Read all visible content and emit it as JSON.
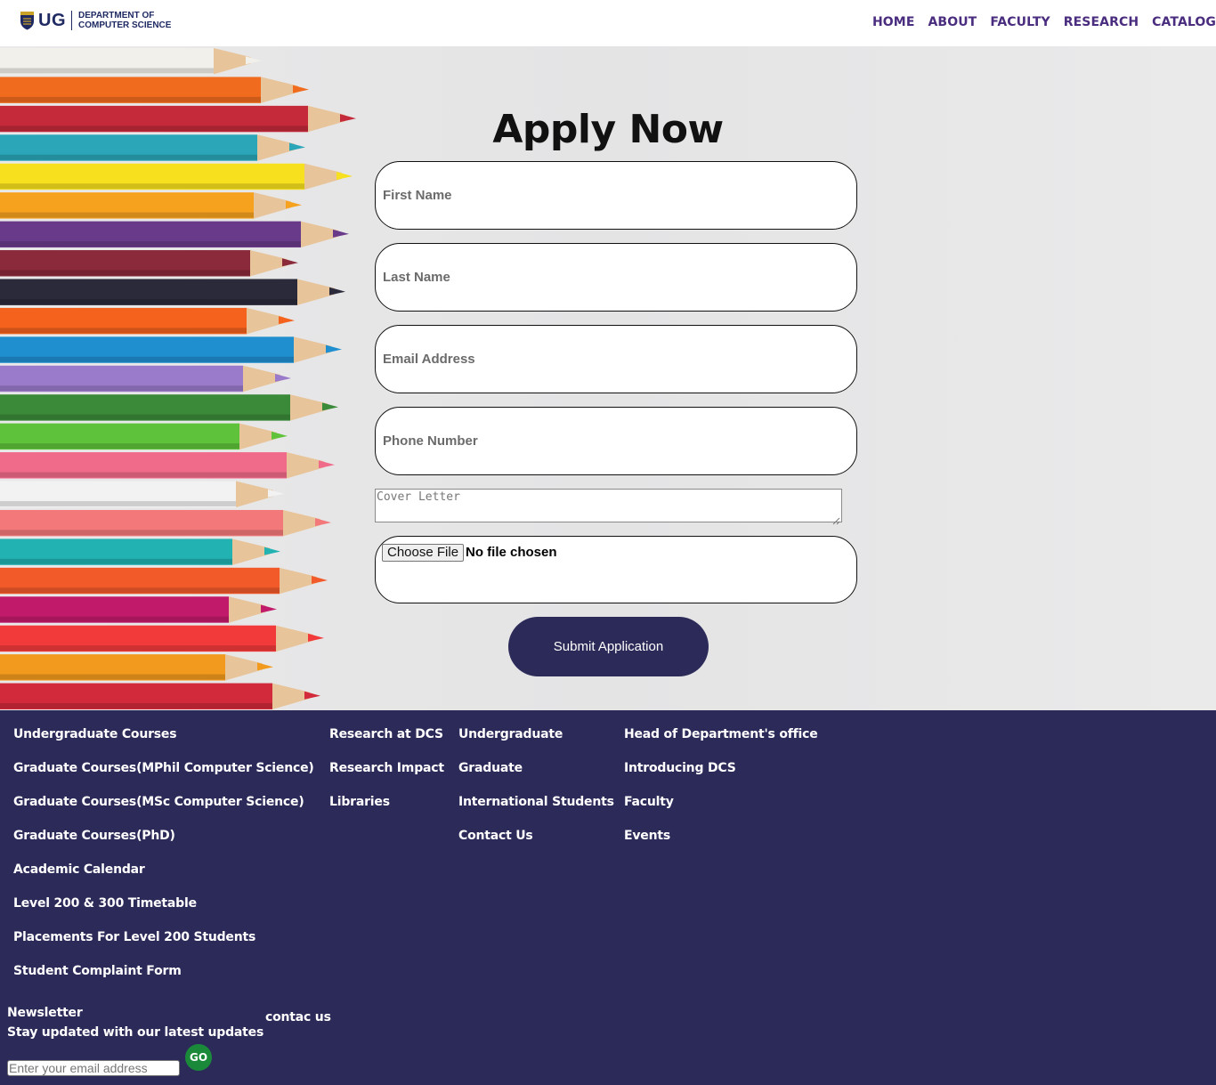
{
  "header": {
    "logo_text": "UG",
    "dept_line1": "DEPARTMENT OF",
    "dept_line2": "COMPUTER SCIENCE",
    "nav": [
      "HOME",
      "ABOUT",
      "FACULTY",
      "RESEARCH",
      "CATALOG"
    ]
  },
  "form": {
    "title": "Apply Now",
    "first_name_placeholder": "First Name",
    "last_name_placeholder": "Last Name",
    "email_placeholder": "Email Address",
    "phone_placeholder": "Phone Number",
    "cover_placeholder": "Cover Letter",
    "choose_file_label": "Choose File",
    "no_file_text": "No file chosen",
    "submit_label": "Submit Application"
  },
  "footer": {
    "columns": [
      [
        "Undergraduate Courses",
        "Graduate Courses(MPhil Computer Science)",
        "Graduate Courses(MSc Computer Science)",
        "Graduate Courses(PhD)",
        "Academic Calendar",
        "Level 200 & 300 Timetable",
        "Placements For Level 200 Students",
        "Student Complaint Form"
      ],
      [
        "Research at DCS",
        "Research Impact",
        "Libraries"
      ],
      [
        "Undergraduate",
        "Graduate",
        "International Students",
        "Contact Us"
      ],
      [
        "Head of Department's office",
        "Introducing DCS",
        "Faculty",
        "Events"
      ]
    ],
    "newsletter_title": "Newsletter",
    "newsletter_sub": "Stay updated with our latest updates",
    "contact_label": "contac us",
    "email_placeholder": "Enter your email address",
    "go_label": "GO"
  },
  "colors": {
    "brand_dark": "#2c2a58",
    "nav_purple": "#4a2d7f",
    "go_green": "#1a8a3a"
  }
}
